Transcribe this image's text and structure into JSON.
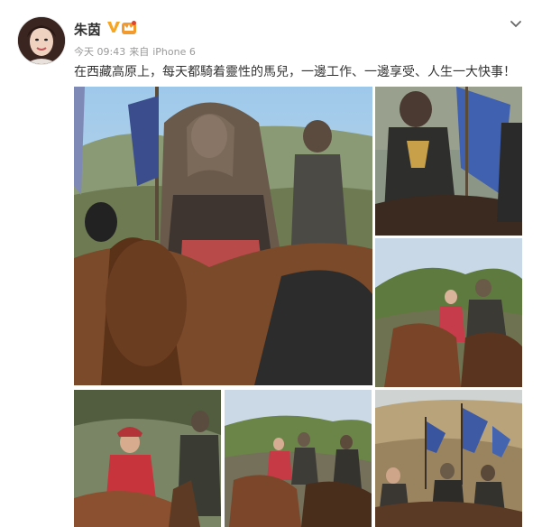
{
  "post": {
    "author": "朱茵",
    "verified_badge_icon": "verified-v-icon",
    "level_badge_icon": "vip-crown-icon",
    "time": "今天 09:43",
    "source_prefix": "来自",
    "source": "iPhone 6",
    "text": "在西藏高原上，每天都騎着靈性的馬兒，一邊工作、一邊享受、人生一大快事！"
  },
  "photos": [
    {
      "name": "woman-riding-horse-photo"
    },
    {
      "name": "armored-rider-flags-photo"
    },
    {
      "name": "riders-mountain-photo"
    },
    {
      "name": "woman-red-costume-photo"
    },
    {
      "name": "group-riders-valley-photo"
    },
    {
      "name": "cavalry-banners-photo"
    }
  ],
  "colors": {
    "username": "#333333",
    "meta": "#999999",
    "verified": "#f6a623",
    "body_text": "#333333"
  }
}
